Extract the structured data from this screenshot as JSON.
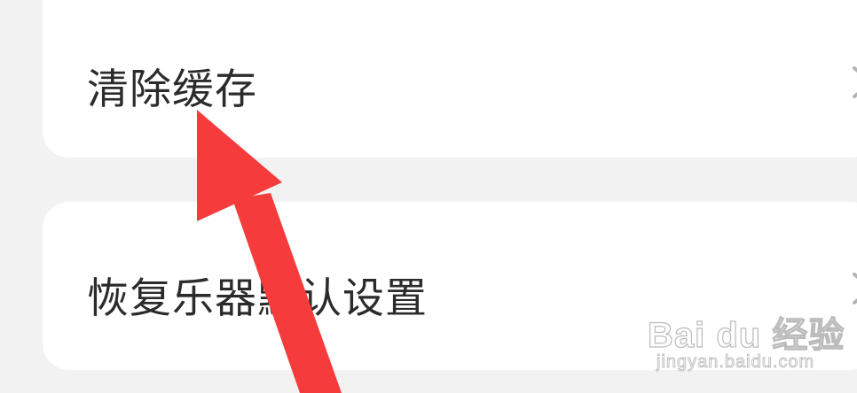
{
  "settings": {
    "items": [
      {
        "label": "清除缓存",
        "chevron_icon": "chevron-right-icon"
      },
      {
        "label": "恢复乐器默认设置",
        "chevron_icon": "chevron-right-icon"
      }
    ]
  },
  "annotation": {
    "arrow_color": "#f53b3b",
    "arrow_icon": "arrow-pointer-icon"
  },
  "watermark": {
    "logo_text": "Bai du 经验",
    "url_text": "jingyan.baidu.com"
  },
  "colors": {
    "background": "#f2f2f2",
    "card": "#ffffff",
    "text": "#2b2b2b",
    "chevron": "#b3b3b3"
  }
}
